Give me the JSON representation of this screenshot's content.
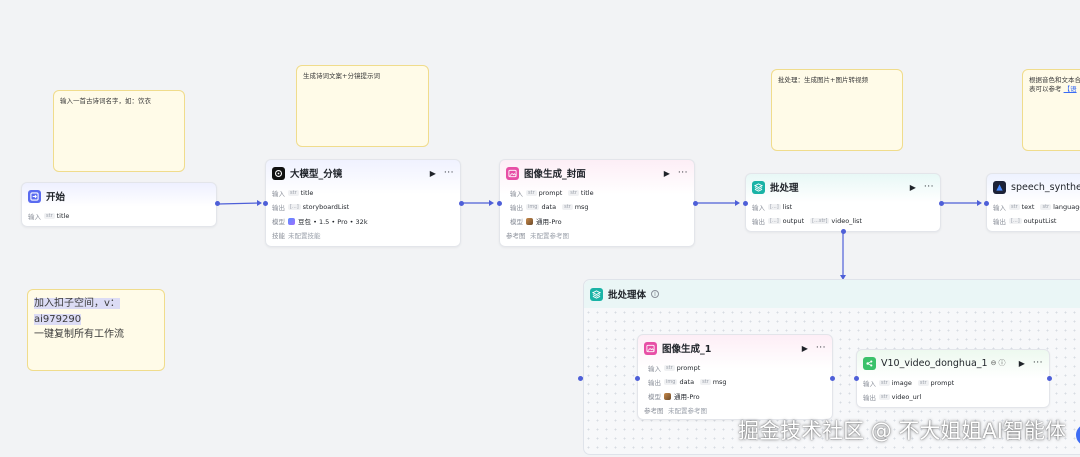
{
  "notes": {
    "n1": "输入一首古诗词名字，如：饮衣",
    "n2": "生成诗词文案+分镜提示词",
    "n3": "批处理：生成图片+图片转视频",
    "n4_line1": "根据音色和文本合",
    "n4_line2": "表可以参考",
    "n4_link": "【语",
    "promo_line1": "加入扣子空间，v：",
    "promo_line2": "ai979290",
    "promo_line3": "一键复制所有工作流"
  },
  "labels": {
    "input": "输入",
    "output": "输出",
    "model": "模型",
    "skill": "技能",
    "ref": "参考图"
  },
  "type_tags": {
    "str": "str",
    "arr": "[...]",
    "img": "img",
    "arr_str": "[...str]"
  },
  "nodes": {
    "start": {
      "title": "开始",
      "input": "title"
    },
    "llm": {
      "title": "大模型_分镜",
      "input": "title",
      "output": "storyboardList",
      "model": "豆包 • 1.5 • Pro • 32k",
      "skill": "未配置技能"
    },
    "img_cover": {
      "title": "图像生成_封面",
      "input1": "prompt",
      "input2": "title",
      "output1": "data",
      "output2": "msg",
      "model": "通用-Pro",
      "ref": "未配置参考图"
    },
    "batch": {
      "title": "批处理",
      "input": "list",
      "output1": "output",
      "output2": "video_list"
    },
    "speech": {
      "title": "speech_synthesis",
      "input1": "text",
      "input2": "language",
      "output": "outputList"
    },
    "batch_body": {
      "title": "批处理体"
    },
    "img1": {
      "title": "图像生成_1",
      "input": "prompt",
      "output1": "data",
      "output2": "msg",
      "model": "通用-Pro",
      "ref": "未配置参考图"
    },
    "video": {
      "title": "V10_video_donghua_1",
      "input1": "image",
      "input2": "prompt",
      "output": "video_url"
    }
  },
  "watermark": "掘金技术社区 @ 不大姐姐AI智能体",
  "colors": {
    "wire": "#4e5fd8",
    "note_bg": "#fffbe8",
    "start_icon": "#5a6bf0",
    "image_icon": "#e74fa6",
    "batch_icon": "#19b3a6",
    "plugin_icon": "#3ac26a",
    "speech_icon": "#1c2237"
  }
}
